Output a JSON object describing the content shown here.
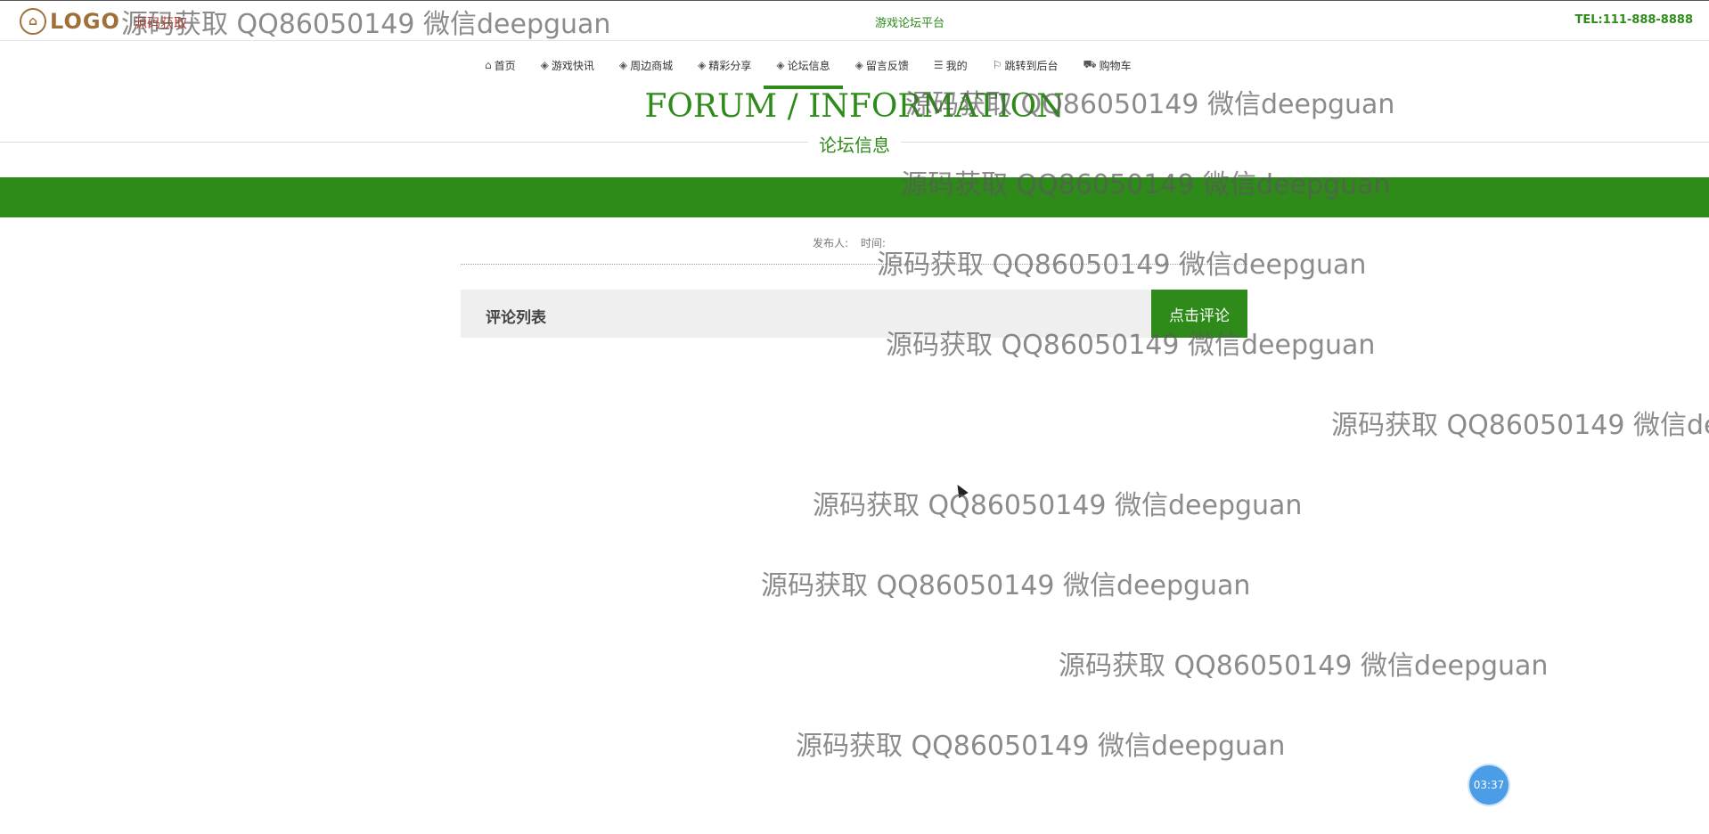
{
  "header": {
    "logo_text": "LOGO",
    "logo_sub": "源码获取",
    "site_name": "游戏论坛平台",
    "tel": "TEL:111-888-8888"
  },
  "nav": {
    "items": [
      {
        "label": "首页",
        "icon": "home-icon"
      },
      {
        "label": "游戏快讯",
        "icon": "cube-icon"
      },
      {
        "label": "周边商城",
        "icon": "cube-icon"
      },
      {
        "label": "精彩分享",
        "icon": "cube-icon"
      },
      {
        "label": "论坛信息",
        "icon": "cube-icon",
        "active": true
      },
      {
        "label": "留言反馈",
        "icon": "cube-icon"
      },
      {
        "label": "我的",
        "icon": "menu-icon"
      },
      {
        "label": "跳转到后台",
        "icon": "flag-icon"
      },
      {
        "label": "购物车",
        "icon": "cart-icon"
      }
    ]
  },
  "page": {
    "title_en": "FORUM / INFORMATION",
    "title_cn": "论坛信息",
    "publisher_label": "发布人:",
    "time_label": "时间:",
    "comment_list_label": "评论列表",
    "comment_button_label": "点击评论"
  },
  "watermark": {
    "text": "源码获取 QQ86050149 微信deepguan"
  },
  "timer": {
    "value": "03:37"
  },
  "colors": {
    "brand_green": "#2e8b1a",
    "logo_brown": "#a0703a",
    "timer_blue": "#4a9de6"
  }
}
